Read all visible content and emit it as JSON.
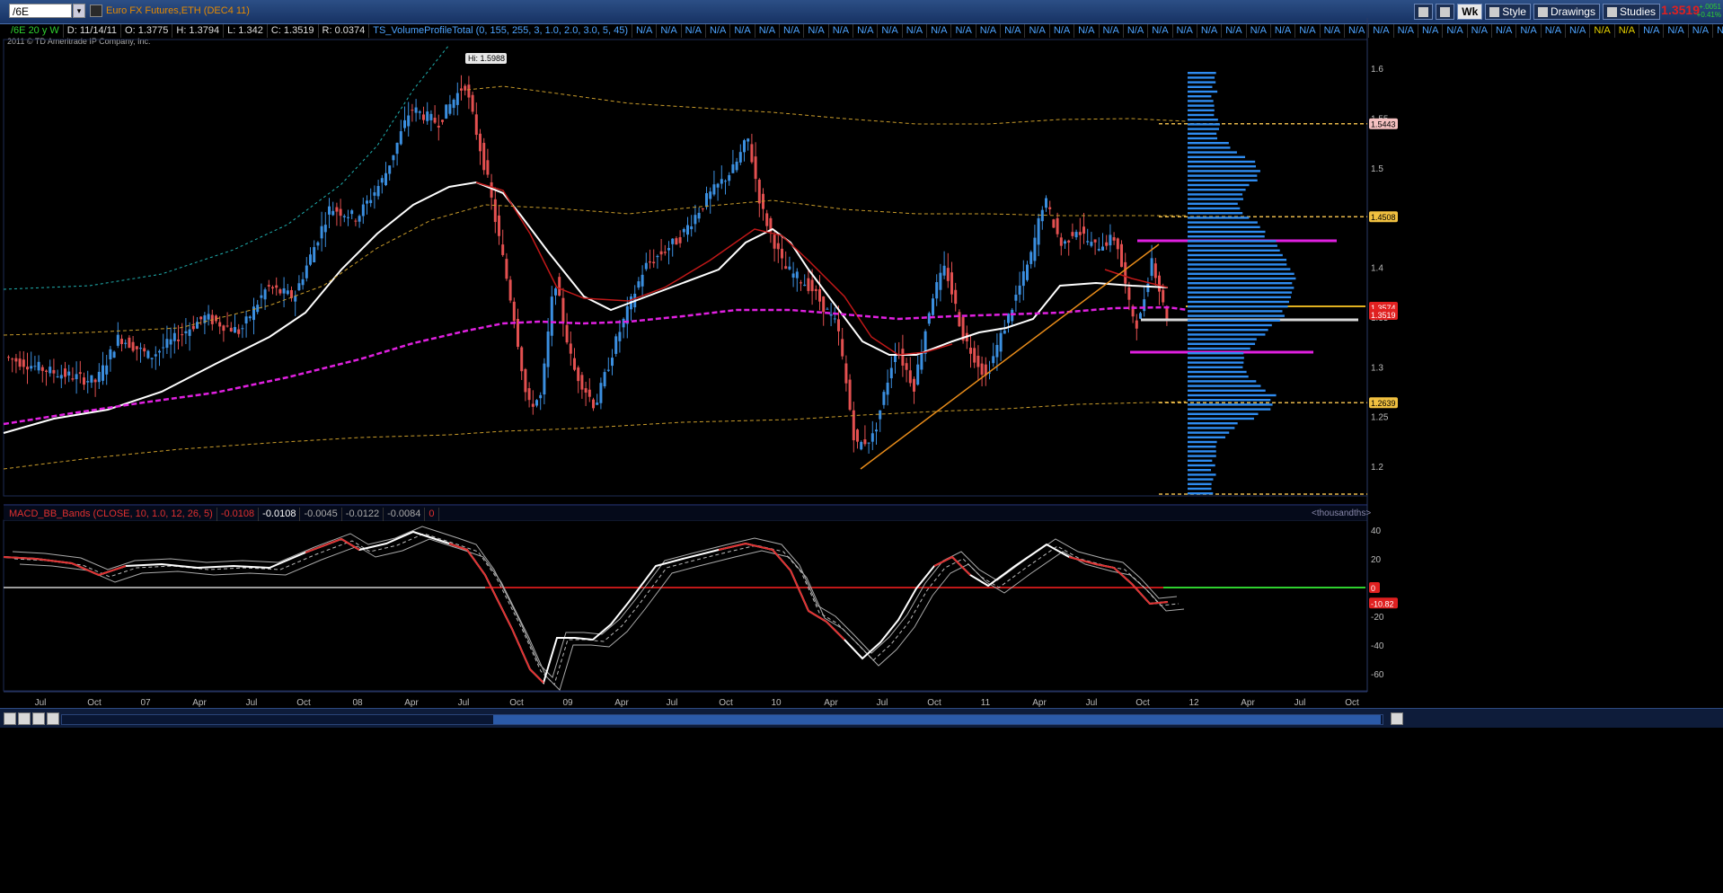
{
  "toolbar": {
    "symbol": "/6E",
    "product_title": "Euro FX Futures,ETH (DEC4 11)",
    "buttons": [
      "Wk",
      "Style",
      "Drawings",
      "Studies"
    ],
    "last_price": "1.3519",
    "change_top": "+.0051",
    "change_bottom": "+0.41%"
  },
  "info": {
    "period": "/6E 20 y W",
    "date": "D: 11/14/11",
    "open": "O: 1.3775",
    "high": "H: 1.3794",
    "low": "L: 1.342",
    "close": "C: 1.3519",
    "range": "R: 0.0374",
    "study": "TS_VolumeProfileTotal (0, 155, 255, 3, 1.0, 2.0, 3.0, 5, 45)",
    "na_label": "N/A"
  },
  "copyright": "2011 © TD Ameritrade IP Company, Inc.",
  "high_tag": "Hi: 1.5988",
  "price_axis": [
    "1.6",
    "1.55",
    "1.5",
    "1.45",
    "1.4",
    "1.35",
    "1.3",
    "1.25",
    "1.2"
  ],
  "price_tags": [
    {
      "label": "1.5443",
      "style": "pink"
    },
    {
      "label": "1.4508",
      "style": "gold"
    },
    {
      "label": "1.3574",
      "style": "red"
    },
    {
      "label": "1.3519",
      "style": "red"
    },
    {
      "label": "1.2639",
      "style": "gold"
    }
  ],
  "macd": {
    "study": "MACD_BB_Bands (CLOSE, 10, 1.0, 12, 26, 5)",
    "values": [
      "-0.0108",
      "-0.0108",
      "-0.0045",
      "-0.0122",
      "-0.0084",
      "0"
    ],
    "units": "<thousandths>",
    "axis": [
      "40",
      "20",
      "0",
      "-20",
      "-40",
      "-60"
    ],
    "zero_tag": "0",
    "value_tag": "-10.82"
  },
  "x_axis": [
    "Jul",
    "Oct",
    "07",
    "Apr",
    "Jul",
    "Oct",
    "08",
    "Apr",
    "Jul",
    "Oct",
    "09",
    "Apr",
    "Jul",
    "Oct",
    "10",
    "Apr",
    "Jul",
    "Oct",
    "11",
    "Apr",
    "Jul",
    "Oct",
    "12",
    "Apr",
    "Jul",
    "Oct"
  ],
  "colors": {
    "up": "#3b8fe0",
    "down": "#e35050",
    "ma_fast": "#ffffff",
    "ma_mid": "#c01818",
    "ma_slow": "#e020e0",
    "band_gold": "#c89b2a",
    "band_teal": "#20b0b0",
    "trend": "#e88c1a",
    "volume_profile": "#2f8cf0",
    "macd_line": "#ffffff",
    "macd_neg": "#e03030"
  }
}
